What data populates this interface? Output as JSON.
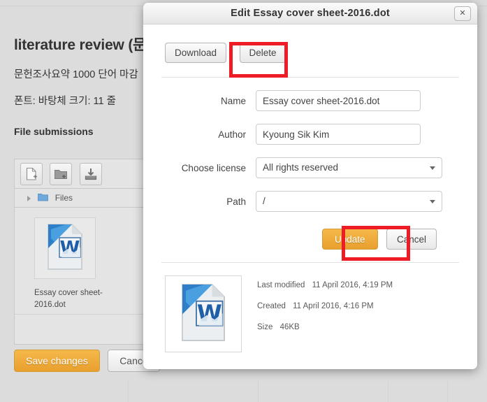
{
  "background": {
    "page_title": "literature review (문",
    "paragraph_1": "문헌조사요약 1000 단어 마감",
    "paragraph_2": "폰트: 바탕체  크기: 11   줄 ",
    "section_heading": "File submissions",
    "filepicker": {
      "toolbar_buttons": [
        {
          "name": "add-file-icon",
          "label": "Create file"
        },
        {
          "name": "add-folder-icon",
          "label": "Create folder"
        },
        {
          "name": "download-all-icon",
          "label": "Download all"
        }
      ],
      "breadcrumb_label": "Files",
      "file_label": "Essay cover sheet-2016.dot",
      "file_icon": "word-document-icon"
    },
    "save_label": "Save changes",
    "cancel_label": "Cance"
  },
  "dialog": {
    "title": "Edit Essay cover sheet-2016.dot",
    "close_icon": "✕",
    "download_label": "Download",
    "delete_label": "Delete",
    "fields": {
      "name_label": "Name",
      "name_value": "Essay cover sheet-2016.dot",
      "author_label": "Author",
      "author_value": "Kyoung Sik Kim",
      "license_label": "Choose license",
      "license_value": "All rights reserved",
      "path_label": "Path",
      "path_value": "/"
    },
    "update_label": "Update",
    "cancel_label": "Cancel",
    "file_preview_icon": "word-document-icon",
    "meta": [
      {
        "key": "Last modified",
        "value": "11 April 2016, 4:19 PM"
      },
      {
        "key": "Created",
        "value": "11 April 2016, 4:16 PM"
      },
      {
        "key": "Size",
        "value": "46KB"
      }
    ]
  },
  "annotations": {
    "accent_color": "#ee1c24",
    "highlighted": [
      "Delete",
      "Update"
    ]
  }
}
